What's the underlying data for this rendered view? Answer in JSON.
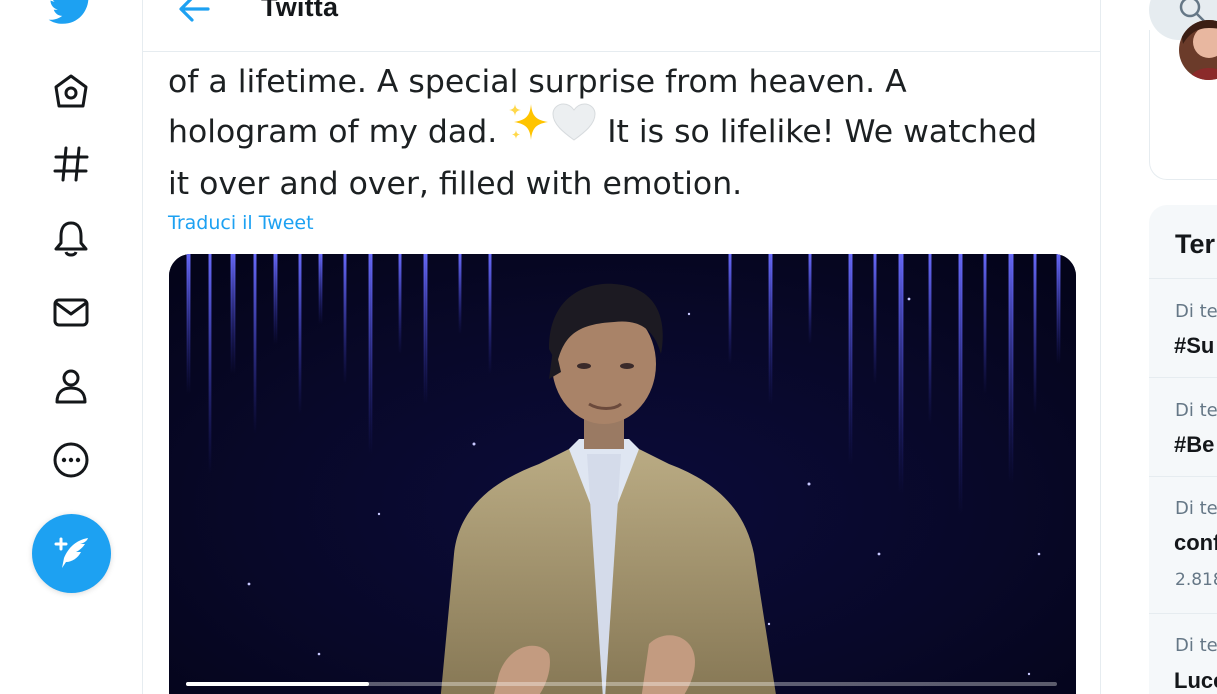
{
  "header": {
    "title": "Twitta",
    "back_icon": "arrow-left-icon"
  },
  "nav": {
    "items": [
      {
        "icon": "home-icon"
      },
      {
        "icon": "hashtag-icon"
      },
      {
        "icon": "bell-icon"
      },
      {
        "icon": "mail-icon"
      },
      {
        "icon": "profile-icon"
      },
      {
        "icon": "more-icon"
      }
    ],
    "compose_icon": "feather-plus-icon",
    "brand_color": "#1da1f2"
  },
  "tweet": {
    "lines": [
      "of a lifetime. A special surprise from heaven. A",
      "it over and over, filled with emotion."
    ],
    "line2_before": "hologram of my dad. ",
    "line2_after": " It is so lifelike! We watched",
    "emoji_icons": [
      "sparkles-icon",
      "white-heart-icon"
    ],
    "translate_label": "Traduci il Tweet"
  },
  "media": {
    "type": "video",
    "progress": 0.21
  },
  "right": {
    "search_icon": "search-icon",
    "trends_title": "Ter",
    "trends": [
      {
        "meta": "Di te",
        "name": "#Su",
        "count": ""
      },
      {
        "meta": "Di te",
        "name": "#Be",
        "count": ""
      },
      {
        "meta": "Di te",
        "name": "conf",
        "count": "2.818"
      },
      {
        "meta": "Di te",
        "name": "Luce",
        "count": ""
      }
    ]
  }
}
